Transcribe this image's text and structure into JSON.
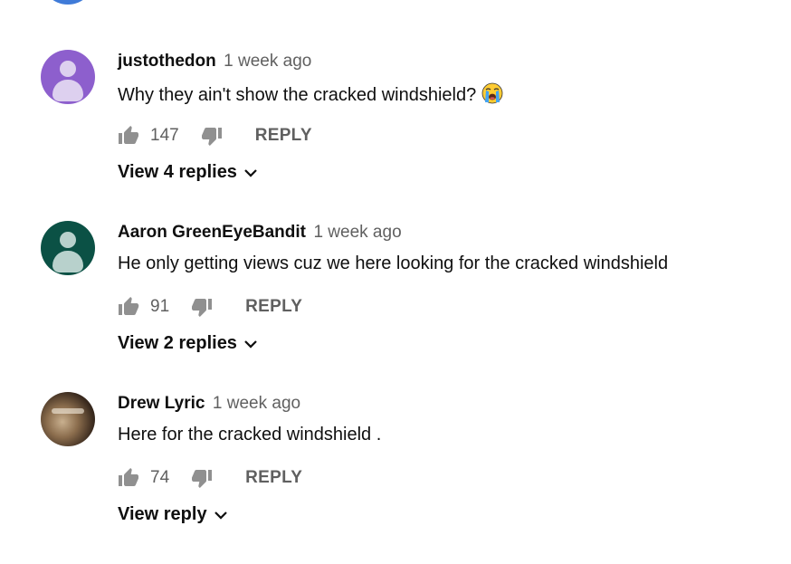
{
  "comments": [
    {
      "author": "justothedon",
      "time": "1 week ago",
      "text": "Why they ain't show the cracked windshield? ",
      "emoji": "loudly-crying-face",
      "likes": "147",
      "reply_label": "REPLY",
      "view_replies": "View 4 replies",
      "avatar_color": "#8d5fcd"
    },
    {
      "author": "Aaron GreenEyeBandit",
      "time": "1 week ago",
      "text": "He only getting views cuz we here looking for the cracked windshield",
      "likes": "91",
      "reply_label": "REPLY",
      "view_replies": "View 2 replies",
      "avatar_color": "#0b5145"
    },
    {
      "author": "Drew Lyric",
      "time": "1 week ago",
      "text": "Here for the cracked windshield .",
      "likes": "74",
      "reply_label": "REPLY",
      "view_replies": "View reply",
      "avatar_color": "#3a2a1e"
    }
  ],
  "colors": {
    "secondary_text": "#606060",
    "primary_text": "#0f0f0f",
    "partial_avatar": "#3f7bd8"
  }
}
